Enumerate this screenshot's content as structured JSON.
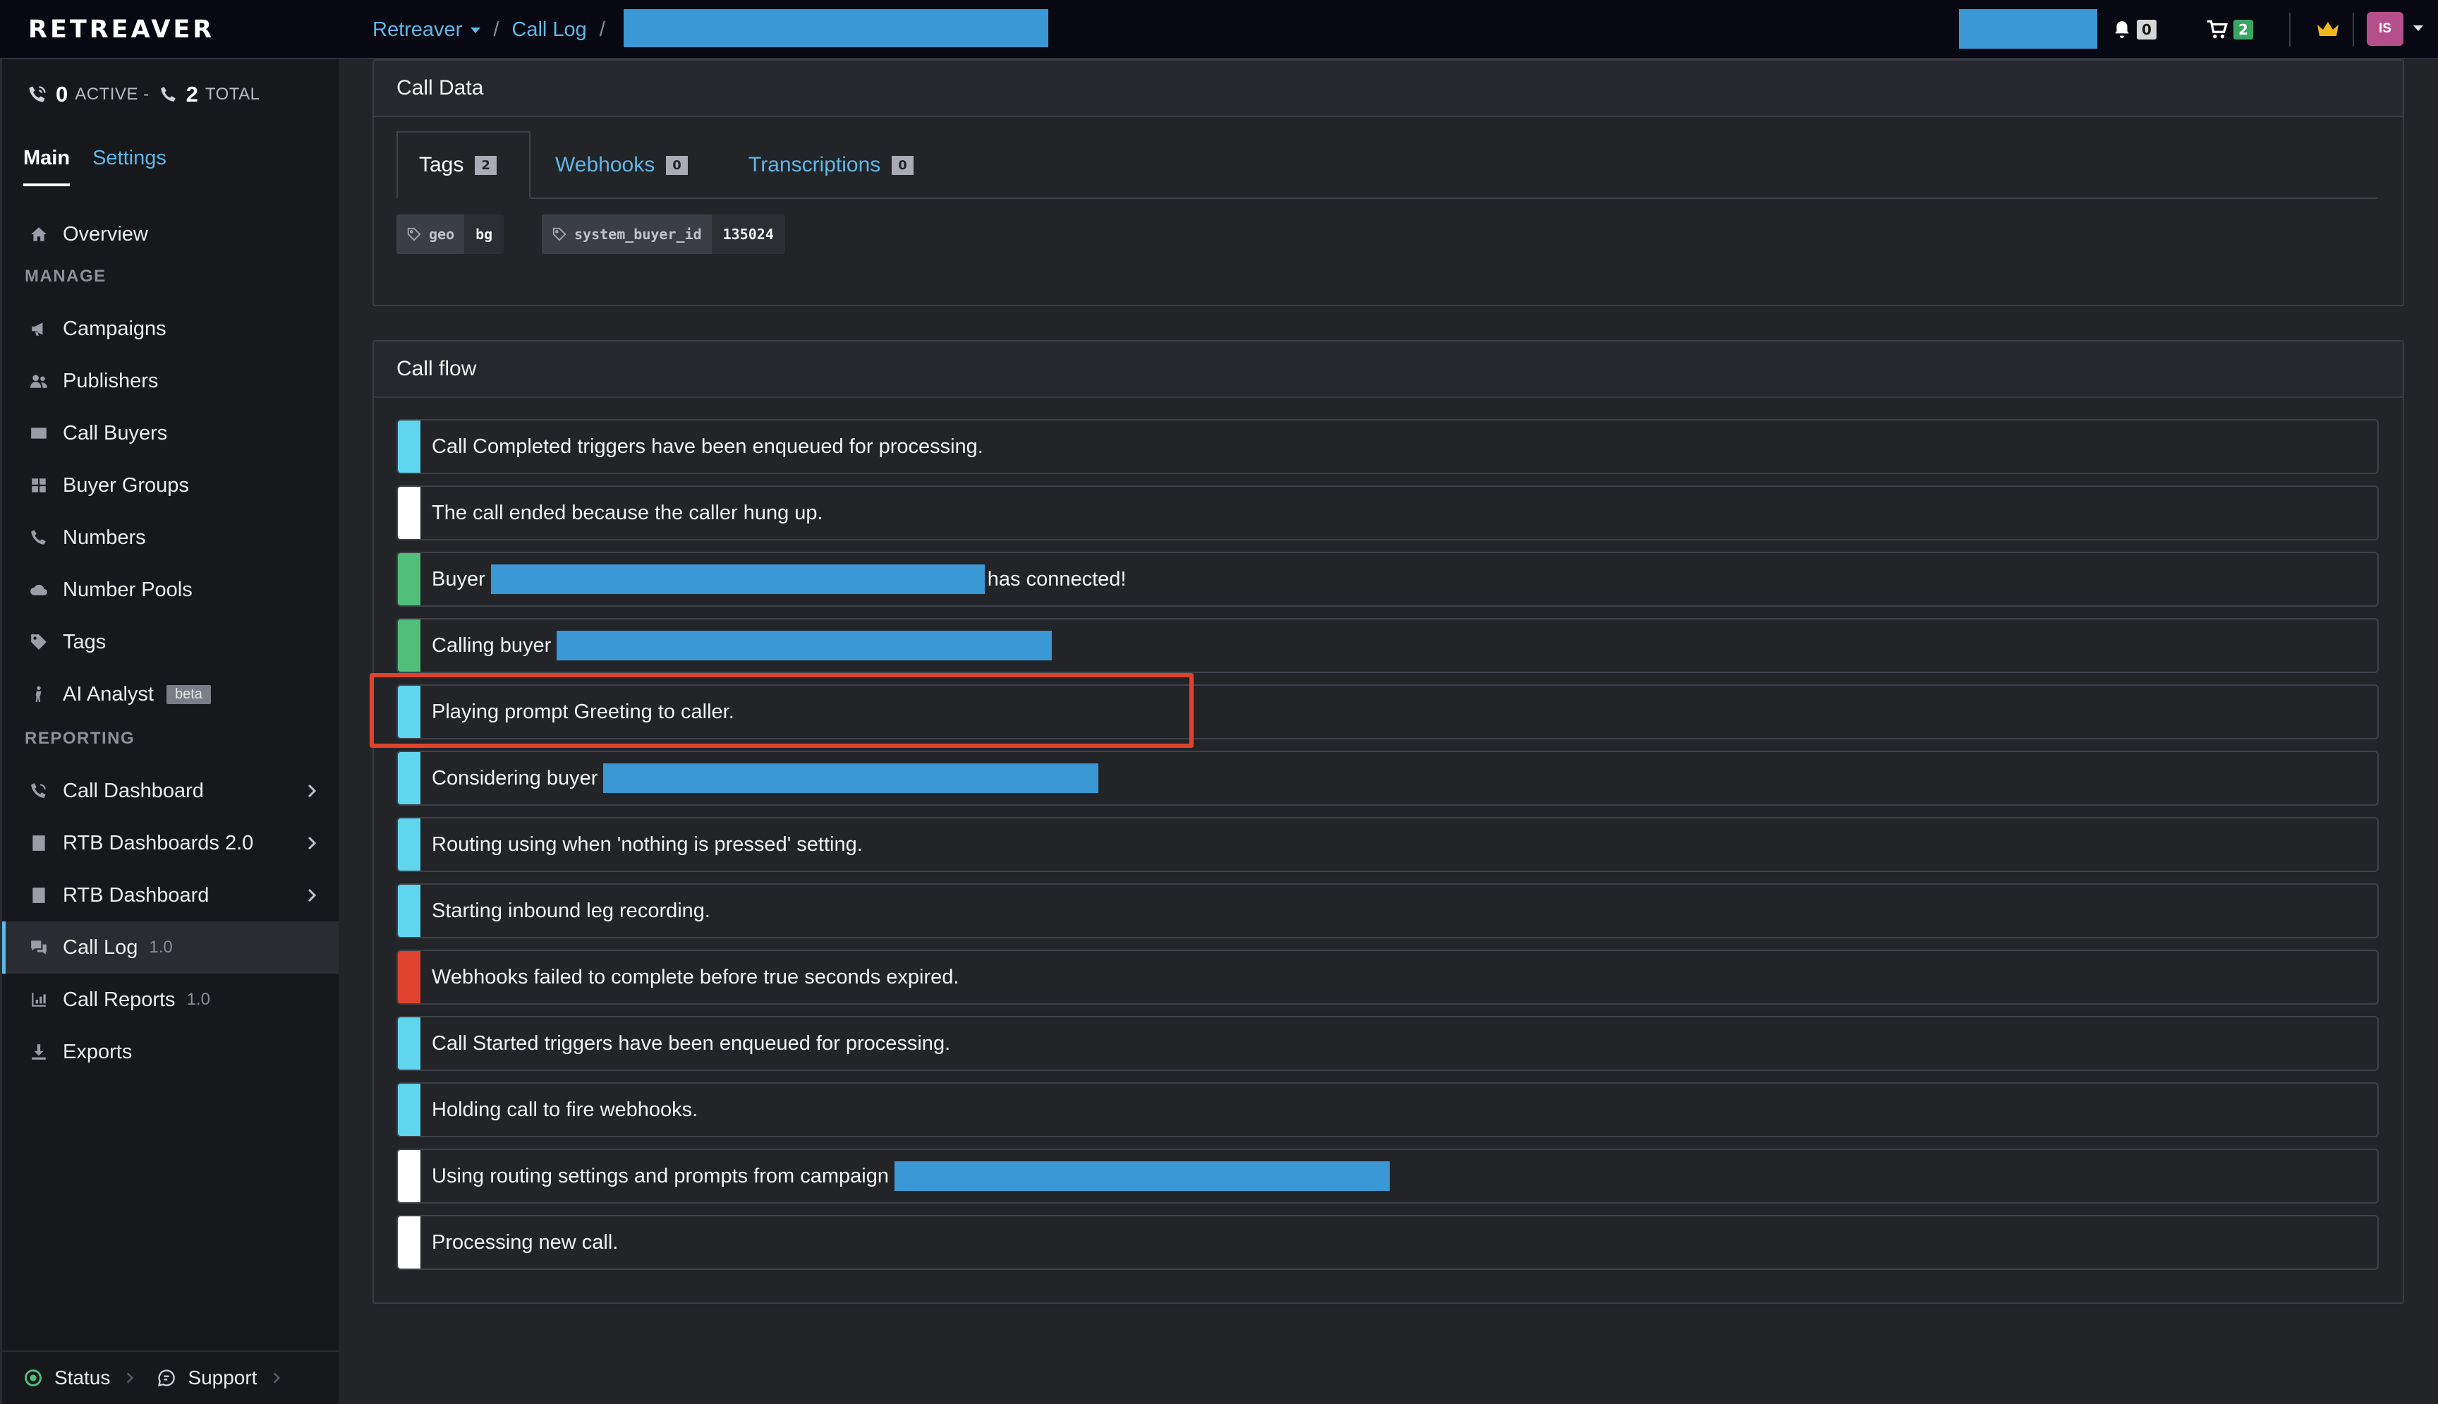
{
  "topbar": {
    "logo": "RETREAVER",
    "breadcrumb": [
      {
        "label": "Retreaver",
        "dropdown": true
      },
      {
        "label": "Call Log"
      }
    ],
    "separator": "/",
    "notifications_count": "0",
    "cart_count": "2",
    "avatar_initials": "IS"
  },
  "sidebar": {
    "active_count": "0",
    "active_label": "ACTIVE -",
    "total_count": "2",
    "total_label": "TOTAL",
    "tabs": [
      {
        "label": "Main",
        "active": true
      },
      {
        "label": "Settings",
        "active": false
      }
    ],
    "overview": {
      "label": "Overview",
      "icon": "home-icon"
    },
    "manage_heading": "MANAGE",
    "manage": [
      {
        "label": "Campaigns",
        "icon": "megaphone-icon"
      },
      {
        "label": "Publishers",
        "icon": "users-icon"
      },
      {
        "label": "Call Buyers",
        "icon": "card-icon"
      },
      {
        "label": "Buyer Groups",
        "icon": "grid-icon"
      },
      {
        "label": "Numbers",
        "icon": "phone-icon"
      },
      {
        "label": "Number Pools",
        "icon": "cloud-icon"
      },
      {
        "label": "Tags",
        "icon": "tag-icon"
      },
      {
        "label": "AI Analyst",
        "icon": "figure-icon",
        "badge": "beta"
      }
    ],
    "reporting_heading": "REPORTING",
    "reporting": [
      {
        "label": "Call Dashboard",
        "icon": "phone-signal-icon",
        "chevron": true
      },
      {
        "label": "RTB Dashboards 2.0",
        "icon": "report-icon",
        "chevron": true
      },
      {
        "label": "RTB Dashboard",
        "icon": "report-icon",
        "chevron": true
      },
      {
        "label": "Call Log",
        "icon": "chat-icon",
        "version": "1.0",
        "active": true
      },
      {
        "label": "Call Reports",
        "icon": "bar-chart-icon",
        "version": "1.0"
      },
      {
        "label": "Exports",
        "icon": "download-icon"
      }
    ],
    "footer": {
      "status": "Status",
      "support": "Support"
    }
  },
  "call_data": {
    "title": "Call Data",
    "tabs": [
      {
        "label": "Tags",
        "count": "2",
        "active": true
      },
      {
        "label": "Webhooks",
        "count": "0",
        "active": false
      },
      {
        "label": "Transcriptions",
        "count": "0",
        "active": false
      }
    ],
    "tags": [
      {
        "key": "geo",
        "value": "bg"
      },
      {
        "key": "system_buyer_id",
        "value": "135024"
      }
    ]
  },
  "call_flow": {
    "title": "Call flow",
    "colors": {
      "cyan": "#5fd6ee",
      "white": "#ffffff",
      "green": "#4fbf7a",
      "red": "#e0432d"
    },
    "events": [
      {
        "text": "Call Completed triggers have been enqueued for processing.",
        "color": "cyan"
      },
      {
        "text": "The call ended because the caller hung up.",
        "color": "white"
      },
      {
        "text": "Buyer",
        "suffix": "has connected!",
        "redacted": true,
        "color": "green"
      },
      {
        "text": "Calling buyer",
        "redacted": true,
        "color": "green"
      },
      {
        "text": "Playing prompt Greeting to caller.",
        "color": "cyan",
        "highlighted": true
      },
      {
        "text": "Considering buyer",
        "redacted": true,
        "color": "cyan"
      },
      {
        "text": "Routing using when 'nothing is pressed' setting.",
        "color": "cyan"
      },
      {
        "text": "Starting inbound leg recording.",
        "color": "cyan"
      },
      {
        "text": "Webhooks failed to complete before true seconds expired.",
        "color": "red"
      },
      {
        "text": "Call Started triggers have been enqueued for processing.",
        "color": "cyan"
      },
      {
        "text": "Holding call to fire webhooks.",
        "color": "cyan"
      },
      {
        "text": "Using routing settings and prompts from campaign",
        "redacted": true,
        "color": "white"
      },
      {
        "text": "Processing new call.",
        "color": "white"
      }
    ]
  }
}
